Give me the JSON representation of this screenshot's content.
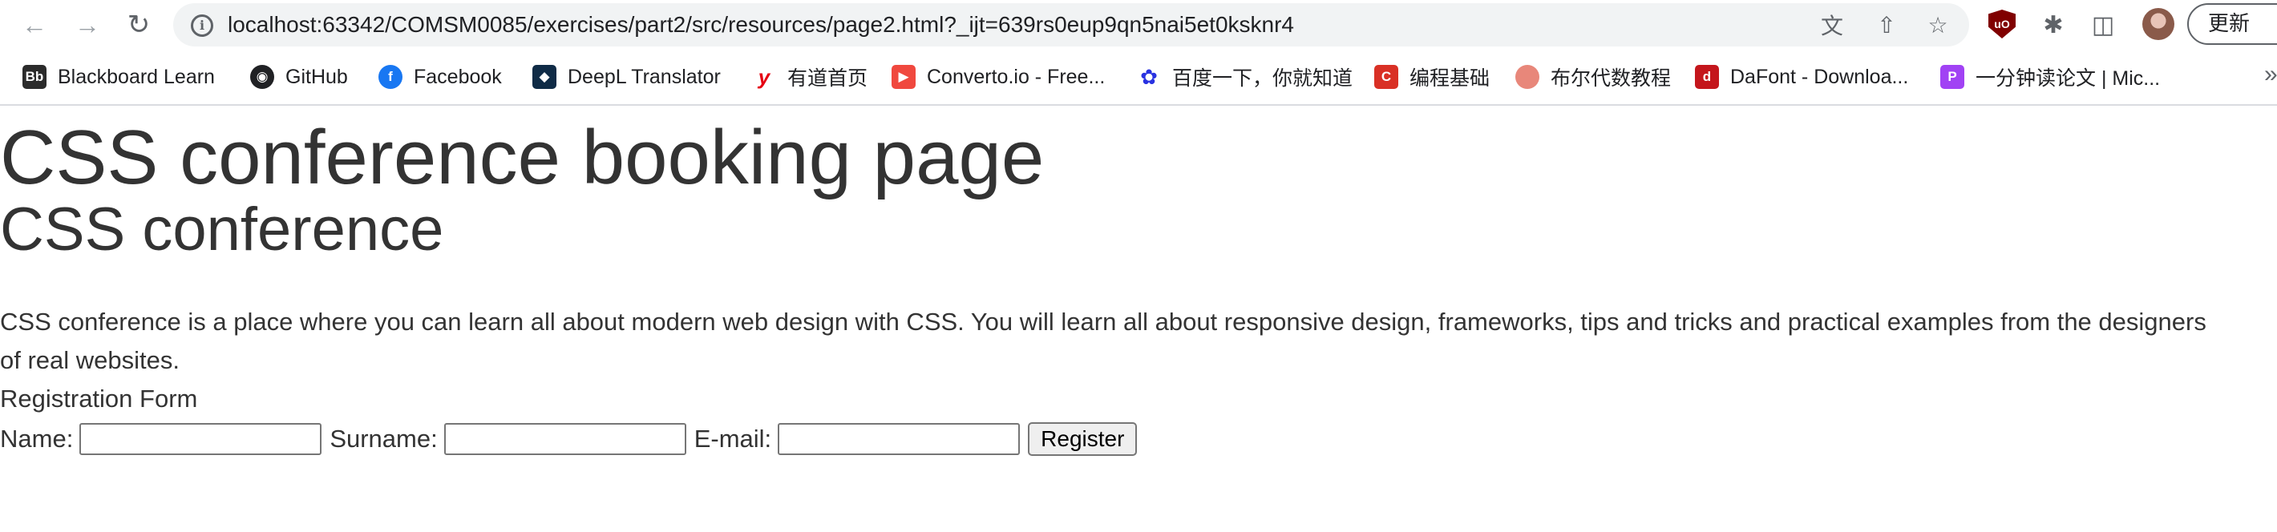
{
  "browser": {
    "url": "localhost:63342/COMSM0085/exercises/part2/src/resources/page2.html?_ijt=639rs0eup9qn5nai5et0ksknr4",
    "update_label": "更新",
    "bookmarks": [
      {
        "label": "Blackboard Learn",
        "icon": "blackboard-icon",
        "color": "#2b2b2b",
        "glyph": "Bb"
      },
      {
        "label": "GitHub",
        "icon": "github-icon",
        "color": "#202124",
        "glyph": "●"
      },
      {
        "label": "Facebook",
        "icon": "facebook-icon",
        "color": "#1877f2",
        "glyph": "f"
      },
      {
        "label": "DeepL Translator",
        "icon": "deepl-icon",
        "color": "#0f2b46",
        "glyph": "◆"
      },
      {
        "label": "有道首页",
        "icon": "youdao-icon",
        "color": "#e60012",
        "glyph": "y"
      },
      {
        "label": "Converto.io - Free...",
        "icon": "converto-icon",
        "color": "#f0483e",
        "glyph": "▶"
      },
      {
        "label": "百度一下，你就知道",
        "icon": "baidu-icon",
        "color": "#2932e1",
        "glyph": "✿"
      },
      {
        "label": "编程基础",
        "icon": "c-icon",
        "color": "#d93025",
        "glyph": "C"
      },
      {
        "label": "布尔代数教程",
        "icon": "circle-icon",
        "color": "#e8877a",
        "glyph": ""
      },
      {
        "label": "DaFont - Downloa...",
        "icon": "dafont-icon",
        "color": "#c4161c",
        "glyph": "d"
      },
      {
        "label": "一分钟读论文 | Mic...",
        "icon": "p-icon",
        "color": "#a142f4",
        "glyph": "P"
      }
    ]
  },
  "page": {
    "h1": "CSS conference booking page",
    "h2": "CSS conference",
    "intro": "CSS conference is a place where you can learn all about modern web design with CSS. You will learn all about responsive design, frameworks, tips and tricks and practical examples from the designers of real websites.",
    "form": {
      "title": "Registration Form",
      "name_label": "Name:",
      "surname_label": "Surname:",
      "email_label": "E-mail:",
      "submit_label": "Register"
    }
  }
}
